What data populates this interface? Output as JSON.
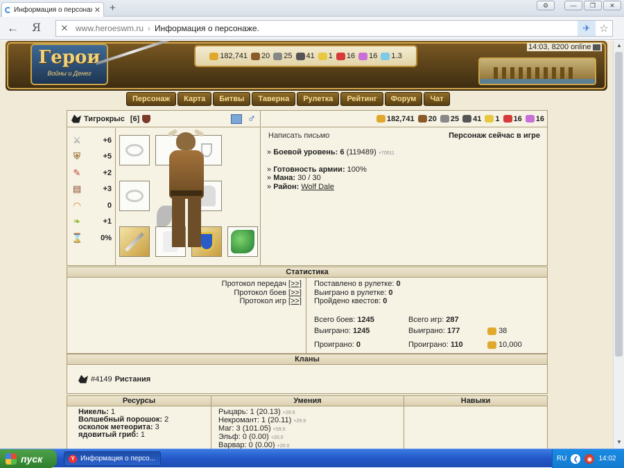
{
  "browser": {
    "tab_title": "Информация о персонаж",
    "url_host": "www.heroeswm.ru",
    "url_sep": "›",
    "url_title": "Информация о персонаже.",
    "back_glyph": "←",
    "ya_glyph": "Я",
    "new_tab_glyph": "+"
  },
  "header": {
    "logo_title": "Герои",
    "logo_subtitle": "Войны и Денег",
    "online_text": "14:03, 8200 online",
    "resources": [
      {
        "name": "gold",
        "value": "182,741",
        "color": "#e0a92e"
      },
      {
        "name": "wood",
        "value": "20",
        "color": "#8a5a2b"
      },
      {
        "name": "ore",
        "value": "25",
        "color": "#888888"
      },
      {
        "name": "mercury",
        "value": "41",
        "color": "#555555"
      },
      {
        "name": "sulfur",
        "value": "1",
        "color": "#e8c840"
      },
      {
        "name": "crystal",
        "value": "16",
        "color": "#d63a3a"
      },
      {
        "name": "gems",
        "value": "16",
        "color": "#c86fd8"
      },
      {
        "name": "diamonds",
        "value": "1.3",
        "color": "#7ec8e8"
      }
    ],
    "nav": [
      "Персонаж",
      "Карта",
      "Битвы",
      "Таверна",
      "Рулетка",
      "Рейтинг",
      "Форум",
      "Чат"
    ]
  },
  "character": {
    "name": "Тигрокрыс",
    "level_tag": "[6]",
    "resources": [
      {
        "name": "gold",
        "value": "182,741",
        "color": "#e0a92e"
      },
      {
        "name": "wood",
        "value": "20",
        "color": "#8a5a2b"
      },
      {
        "name": "ore",
        "value": "25",
        "color": "#888888"
      },
      {
        "name": "mercury",
        "value": "41",
        "color": "#555555"
      },
      {
        "name": "sulfur",
        "value": "1",
        "color": "#e8c840"
      },
      {
        "name": "crystal",
        "value": "16",
        "color": "#d63a3a"
      },
      {
        "name": "gems",
        "value": "16",
        "color": "#c86fd8"
      }
    ],
    "stats": [
      {
        "icon": "attack-icon",
        "glyph": "⚔",
        "value": "+6"
      },
      {
        "icon": "defense-icon",
        "glyph": "🛡",
        "value": "+5"
      },
      {
        "icon": "spellpower-icon",
        "glyph": "✎",
        "value": "+2"
      },
      {
        "icon": "knowledge-icon",
        "glyph": "📖",
        "value": "+3"
      },
      {
        "icon": "luck-icon",
        "glyph": "🌈",
        "value": "0"
      },
      {
        "icon": "morale-icon",
        "glyph": "❤",
        "value": "+1"
      },
      {
        "icon": "initiative-icon",
        "glyph": "⌛",
        "value": "0%"
      }
    ],
    "write_letter": "Написать письмо",
    "status": "Персонаж сейчас в игре",
    "info": {
      "combat_level_label": "Боевой уровень:",
      "combat_level_value": "6",
      "combat_exp": "(119489)",
      "combat_exp_small": "+70511",
      "army_label": "Готовность армии:",
      "army_value": "100%",
      "mana_label": "Мана:",
      "mana_value": "30 / 30",
      "district_label": "Район:",
      "district_value": "Wolf Dale"
    }
  },
  "statistics": {
    "header": "Статистика",
    "protocols": [
      {
        "label": "Протокол передач",
        "link": "[>>]"
      },
      {
        "label": "Протокол боев",
        "link": "[>>]"
      },
      {
        "label": "Протокол игр",
        "link": "[>>]"
      }
    ],
    "roulette_bet_label": "Поставлено в рулетке:",
    "roulette_bet_value": "0",
    "roulette_won_label": "Выиграно в рулетке:",
    "roulette_won_value": "0",
    "quests_label": "Пройдено квестов:",
    "quests_value": "0",
    "total_battles_label": "Всего боев:",
    "total_battles_value": "1245",
    "won_battles_label": "Выиграно:",
    "won_battles_value": "1245",
    "lost_battles_label": "Проиграно:",
    "lost_battles_value": "0",
    "total_games_label": "Всего игр:",
    "total_games_value": "287",
    "won_games_label": "Выиграно:",
    "won_games_value": "177",
    "won_games_gold": "38",
    "lost_games_label": "Проиграно:",
    "lost_games_value": "110",
    "lost_games_gold": "10,000"
  },
  "clans": {
    "header": "Кланы",
    "clan_id": "#4149",
    "clan_name": "Ристания"
  },
  "resources_section": {
    "headers": {
      "resources": "Ресурсы",
      "skills": "Умения",
      "talents": "Навыки"
    },
    "items": [
      {
        "name": "Никель:",
        "value": "1"
      },
      {
        "name": "Волшебный порошок:",
        "value": "2"
      },
      {
        "name": "осколок метеорита:",
        "value": "3"
      },
      {
        "name": "ядовитый гриб:",
        "value": "1"
      }
    ],
    "skills": [
      {
        "name": "Рыцарь:",
        "value": "1 (20.13)",
        "small": "+29.9"
      },
      {
        "name": "Некромант:",
        "value": "1 (20.11)",
        "small": "+29.9"
      },
      {
        "name": "Маг:",
        "value": "3 (101.05)",
        "small": "+59.0"
      },
      {
        "name": "Эльф:",
        "value": "0 (0.00)",
        "small": "+20.0"
      },
      {
        "name": "Варвар:",
        "value": "0 (0.00)",
        "small": "+20.0"
      }
    ]
  },
  "taskbar": {
    "start_label": "пуск",
    "task_title": "Информация о персо...",
    "lang": "RU",
    "clock": "14:02"
  }
}
